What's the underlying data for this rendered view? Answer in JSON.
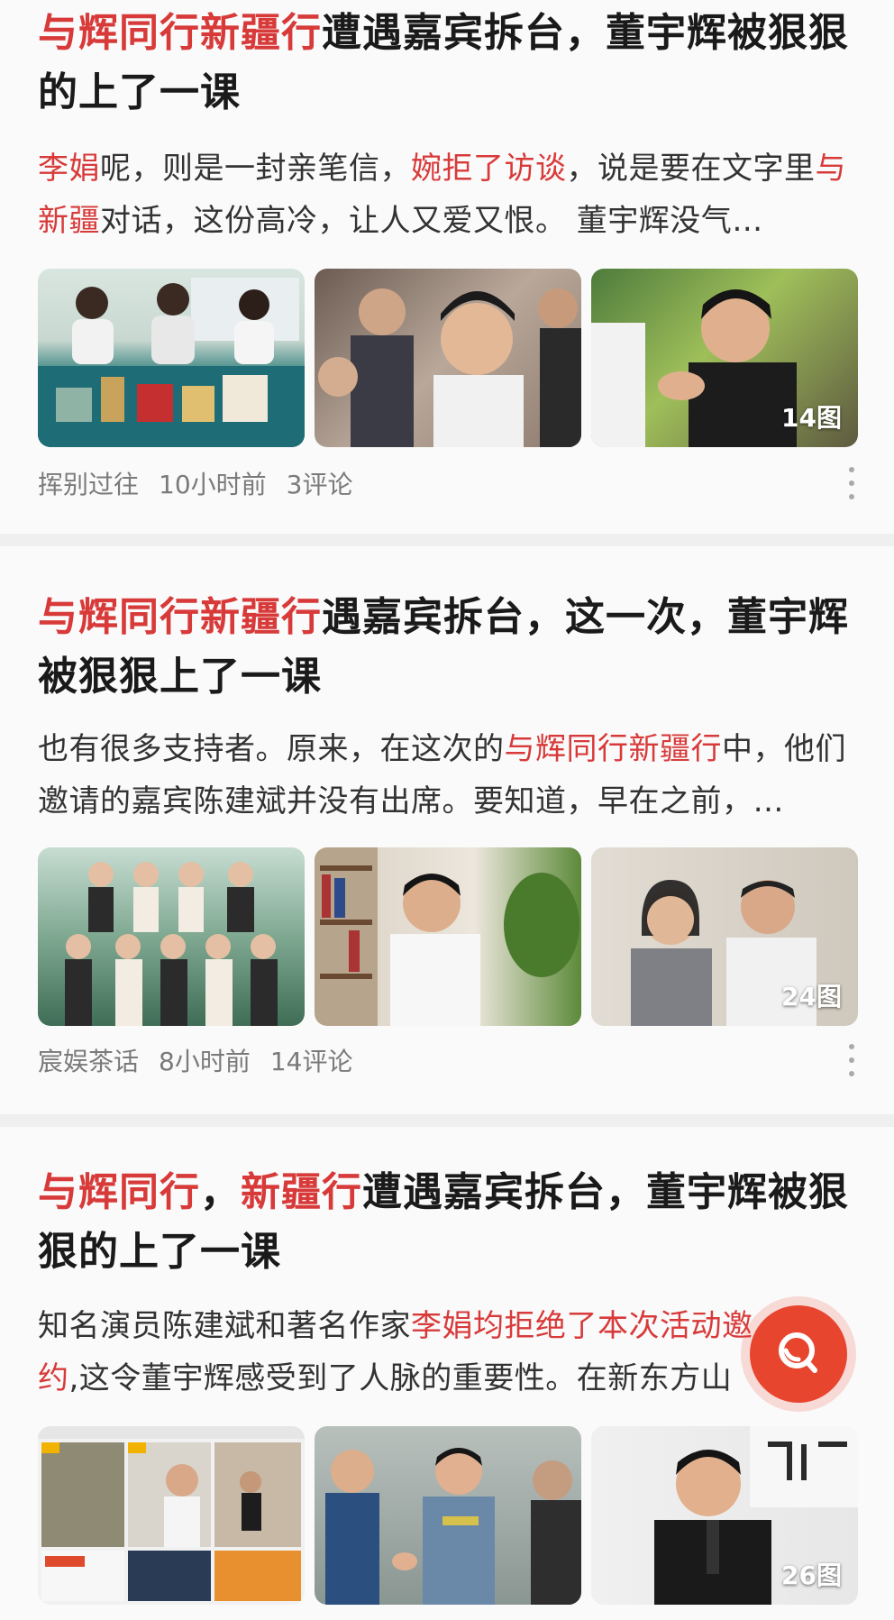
{
  "articles": [
    {
      "title_hl": "与辉同行新疆行",
      "title_rest": "遭遇嘉宾拆台，董宇辉被狠狠的上了一课",
      "snippet_parts": [
        {
          "text": "李娟",
          "hl": true
        },
        {
          "text": "呢，则是一封亲笔信，",
          "hl": false
        },
        {
          "text": "婉拒了访谈",
          "hl": true
        },
        {
          "text": "，说是要在文字里",
          "hl": false
        },
        {
          "text": "与新疆",
          "hl": true
        },
        {
          "text": "对话，这份高冷，让人又爱又恨。 董宇辉没气…",
          "hl": false
        }
      ],
      "image_count": "14图",
      "author": "挥别过往",
      "time": "10小时前",
      "comments": "3评论"
    },
    {
      "title_hl": "与辉同行新疆行",
      "title_rest": "遇嘉宾拆台，这一次，董宇辉被狠狠上了一课",
      "snippet_parts": [
        {
          "text": "也有很多支持者。原来，在这次的",
          "hl": false
        },
        {
          "text": "与辉同行新疆行",
          "hl": true
        },
        {
          "text": "中，他们邀请的嘉宾陈建斌并没有出席。要知道，早在之前，…",
          "hl": false
        }
      ],
      "image_count": "24图",
      "author": "宸娱茶话",
      "time": "8小时前",
      "comments": "14评论"
    },
    {
      "title_hl": "与辉同行",
      "title_mid": "，",
      "title_hl2": "新疆行",
      "title_rest": "遭遇嘉宾拆台，董宇辉被狠狠的上了一课",
      "snippet_parts": [
        {
          "text": "知名演员陈建斌和著名作家",
          "hl": false
        },
        {
          "text": "李娟均拒绝了本次活动邀约",
          "hl": true
        },
        {
          "text": ",这令董宇辉感受到了人脉的重要性。在新东方山",
          "hl": false
        }
      ],
      "image_count": "26图"
    }
  ],
  "colors": {
    "highlight": "#d83a3a",
    "fab": "#e8452f"
  },
  "fab_icon": "search-icon"
}
